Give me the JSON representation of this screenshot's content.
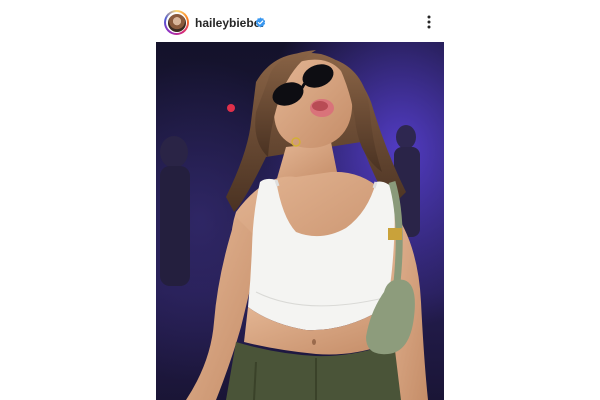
{
  "post": {
    "username": "haileybieber",
    "verified": true,
    "icons": {
      "avatar": "profile-avatar",
      "verified": "verified-badge-icon",
      "more": "more-options-icon"
    },
    "colors": {
      "verified": "#3897f0",
      "text": "#262626"
    }
  }
}
